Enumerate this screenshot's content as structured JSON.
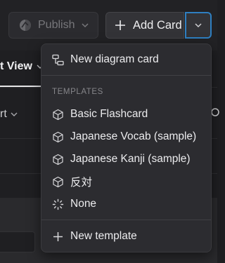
{
  "toolbar": {
    "publish_label": "Publish",
    "add_card_label": "Add Card"
  },
  "background": {
    "view_tab_label": "t View",
    "sort_label": "rt"
  },
  "menu": {
    "new_diagram_card": "New diagram card",
    "templates_heading": "TEMPLATES",
    "templates": [
      "Basic Flashcard",
      "Japanese Vocab (sample)",
      "Japanese Kanji (sample)",
      "反対",
      "None"
    ],
    "new_template": "New template"
  },
  "colors": {
    "focus_ring": "#2f7fc1",
    "menu_bg": "#2c2c30",
    "app_bg": "#1f1f22"
  }
}
